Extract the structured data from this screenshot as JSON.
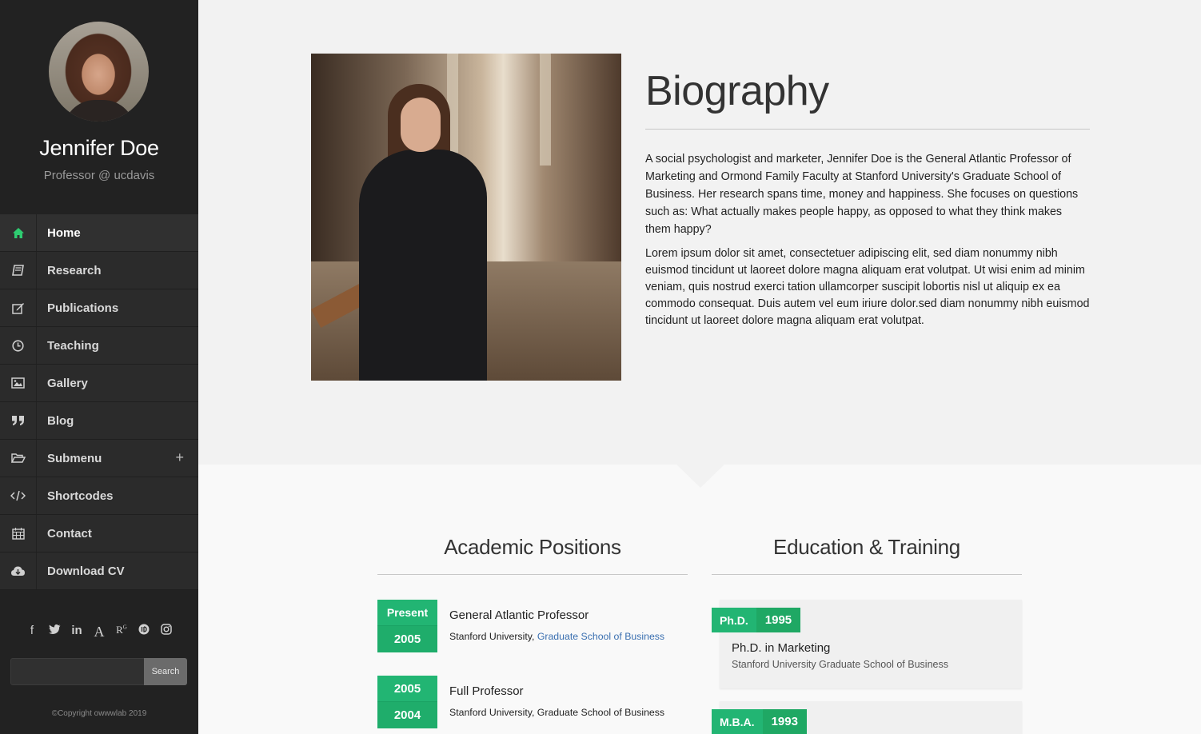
{
  "profile": {
    "name": "Jennifer Doe",
    "role": "Professor @ ucdavis"
  },
  "nav": {
    "items": [
      {
        "label": "Home",
        "icon": "home-icon",
        "active": true
      },
      {
        "label": "Research",
        "icon": "book-icon"
      },
      {
        "label": "Publications",
        "icon": "edit-icon"
      },
      {
        "label": "Teaching",
        "icon": "clock-icon"
      },
      {
        "label": "Gallery",
        "icon": "image-icon"
      },
      {
        "label": "Blog",
        "icon": "quote-icon"
      },
      {
        "label": "Submenu",
        "icon": "folder-open-icon",
        "expand": "+"
      },
      {
        "label": "Shortcodes",
        "icon": "code-icon"
      },
      {
        "label": "Contact",
        "icon": "calendar-icon"
      },
      {
        "label": "Download CV",
        "icon": "cloud-download-icon"
      }
    ]
  },
  "social": [
    "facebook-icon",
    "twitter-icon",
    "linkedin-icon",
    "academia-icon",
    "researchgate-icon",
    "ideas-icon",
    "instagram-icon"
  ],
  "search": {
    "placeholder": "",
    "button_label": "Search"
  },
  "footer": {
    "copyright": "©Copyright owwwlab 2019"
  },
  "bio": {
    "title": "Biography",
    "paragraph1": "A social psychologist and marketer, Jennifer Doe is the General Atlantic Professor of Marketing and Ormond Family Faculty at Stanford University's Graduate School of Business. Her research spans time, money and happiness. She focuses on questions such as: What actually makes people happy, as opposed to what they think makes them happy?",
    "paragraph2": "Lorem ipsum dolor sit amet, consectetuer adipiscing elit, sed diam nonummy nibh euismod tincidunt ut laoreet dolore magna aliquam erat volutpat. Ut wisi enim ad minim veniam, quis nostrud exerci tation ullamcorper suscipit lobortis nisl ut aliquip ex ea commodo consequat. Duis autem vel eum iriure dolor.sed diam nonummy nibh euismod tincidunt ut laoreet dolore magna aliquam erat volutpat."
  },
  "academic": {
    "title": "Academic Positions",
    "positions": [
      {
        "to": "Present",
        "from": "2005",
        "title": "General Atlantic Professor",
        "org": "Stanford University, ",
        "org_link": "Graduate School of Business"
      },
      {
        "to": "2005",
        "from": "2004",
        "title": "Full Professor",
        "org": "Stanford University, Graduate School of Business",
        "org_link": ""
      }
    ]
  },
  "education": {
    "title": "Education & Training",
    "items": [
      {
        "degree": "Ph.D.",
        "year": "1995",
        "title": "Ph.D. in Marketing",
        "org": "Stanford University Graduate School of Business"
      },
      {
        "degree": "M.B.A.",
        "year": "1993",
        "title": "",
        "org": ""
      }
    ]
  },
  "colors": {
    "accent": "#22b573",
    "sidebar_bg": "#222222",
    "link": "#3a6fb0"
  }
}
